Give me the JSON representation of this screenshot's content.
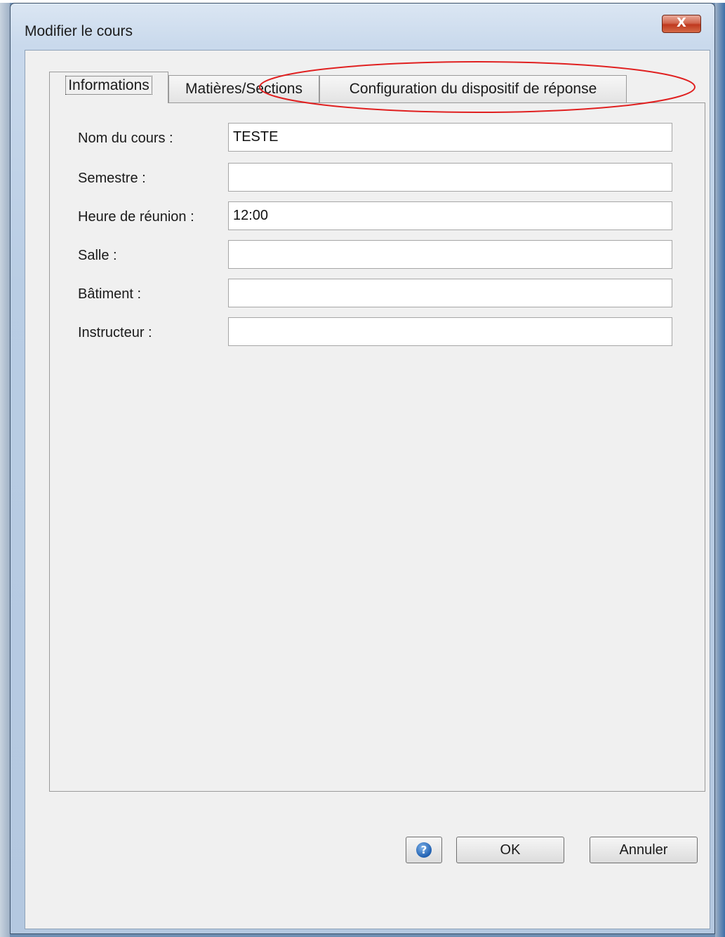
{
  "window": {
    "title": "Modifier le cours",
    "close_glyph": "X"
  },
  "tabs": [
    {
      "label": "Informations",
      "active": true
    },
    {
      "label": "Matières/Sections",
      "active": false
    },
    {
      "label": "Configuration du dispositif de réponse",
      "active": false
    }
  ],
  "form": {
    "fields": [
      {
        "label": "Nom du cours :",
        "value": "TESTE"
      },
      {
        "label": "Semestre :",
        "value": ""
      },
      {
        "label": "Heure de réunion :",
        "value": "12:00"
      },
      {
        "label": "Salle :",
        "value": ""
      },
      {
        "label": "Bâtiment :",
        "value": ""
      },
      {
        "label": "Instructeur :",
        "value": ""
      }
    ]
  },
  "buttons": {
    "help_glyph": "?",
    "ok_label": "OK",
    "cancel_label": "Annuler"
  },
  "annotation": {
    "shape": "ellipse",
    "color": "#e02020",
    "target": "tab-configuration"
  },
  "colors": {
    "client_bg": "#f0f0f0",
    "frame": "#b9cde4",
    "close_button": "#c0391f"
  }
}
